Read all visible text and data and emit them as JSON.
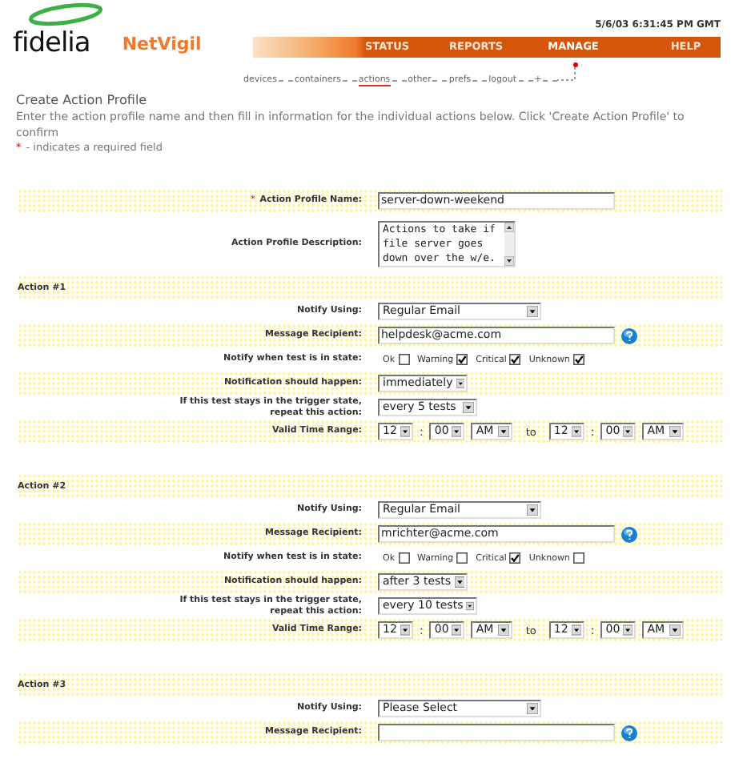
{
  "header": {
    "logo": "fidelia",
    "brand": "NetVigil",
    "datetime": "5/6/03 6:31:45 PM GMT",
    "nav": [
      {
        "label": "STATUS",
        "selected": false
      },
      {
        "label": "REPORTS",
        "selected": false
      },
      {
        "label": "MANAGE",
        "selected": true
      },
      {
        "label": "HELP",
        "selected": false
      }
    ],
    "subnav": [
      {
        "label": "devices",
        "selected": false
      },
      {
        "label": "containers",
        "selected": false
      },
      {
        "label": "actions",
        "selected": true
      },
      {
        "label": "other",
        "selected": false
      },
      {
        "label": "prefs",
        "selected": false
      },
      {
        "label": "logout",
        "selected": false
      },
      {
        "label": "+",
        "selected": false
      }
    ]
  },
  "page": {
    "title": "Create Action Profile",
    "intro": "Enter the action profile name and then fill in information for the individual actions below. Click 'Create Action Profile' to confirm",
    "required_mark": "*",
    "required_note": "- indicates a required field"
  },
  "profile": {
    "name_label": "Action Profile Name:",
    "name_required_mark": "*",
    "name_value": "server-down-weekend",
    "description_label": "Action Profile Description:",
    "description_value": "Actions to take if file server goes down over the w/e."
  },
  "actions": [
    {
      "title": "Action #1",
      "notify_label": "Notify Using:",
      "notify_value": "Regular Email",
      "recipient_label": "Message Recipient:",
      "recipient_value": "helpdesk@acme.com",
      "states_label": "Notify when test is in state:",
      "states": [
        {
          "label": "Ok",
          "checked": false
        },
        {
          "label": "Warning",
          "checked": true
        },
        {
          "label": "Critical",
          "checked": true
        },
        {
          "label": "Unknown",
          "checked": true
        }
      ],
      "timing_label": "Notification should happen:",
      "timing_value": "immediately",
      "repeat_label": "If this test stays in the trigger state, repeat this action:",
      "repeat_value": "every 5 tests",
      "range_label": "Valid Time Range:",
      "range_from": [
        "12",
        "00",
        "AM"
      ],
      "range_colon": ":",
      "range_to_word": "to",
      "range_to": [
        "12",
        "00",
        "AM"
      ],
      "range_to_colon": ":"
    },
    {
      "title": "Action #2",
      "notify_label": "Notify Using:",
      "notify_value": "Regular Email",
      "recipient_label": "Message Recipient:",
      "recipient_value": "mrichter@acme.com",
      "states_label": "Notify when test is in state:",
      "states": [
        {
          "label": "Ok",
          "checked": false
        },
        {
          "label": "Warning",
          "checked": false
        },
        {
          "label": "Critical",
          "checked": true
        },
        {
          "label": "Unknown",
          "checked": false
        }
      ],
      "timing_label": "Notification should happen:",
      "timing_value": "after 3 tests",
      "repeat_label": "If this test stays in the trigger state, repeat this action:",
      "repeat_value": "every 10 tests",
      "range_label": "Valid Time Range:",
      "range_from": [
        "12",
        "00",
        "AM"
      ],
      "range_colon": ":",
      "range_to_word": "to",
      "range_to": [
        "12",
        "00",
        "AM"
      ],
      "range_to_colon": ":"
    },
    {
      "title": "Action #3",
      "notify_label": "Notify Using:",
      "notify_value": "Please Select",
      "recipient_label": "Message Recipient:"
    }
  ]
}
